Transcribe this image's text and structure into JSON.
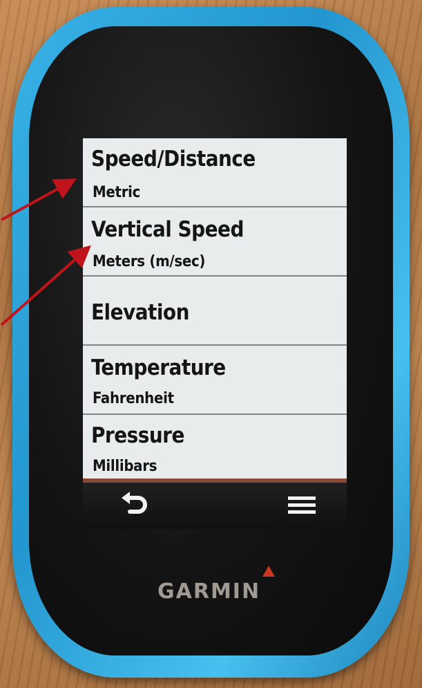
{
  "device": {
    "brand": "GARMIN"
  },
  "screen": {
    "menu_items": [
      {
        "title": "Speed/Distance",
        "subtitle": "Metric"
      },
      {
        "title": "Vertical Speed",
        "subtitle": "Meters (m/sec)"
      },
      {
        "title": "Elevation",
        "subtitle": ""
      },
      {
        "title": "Temperature",
        "subtitle": "Fahrenheit"
      },
      {
        "title": "Pressure",
        "subtitle": "Millibars"
      }
    ],
    "softkeys": {
      "back_icon": "back-arrow-icon",
      "menu_icon": "hamburger-menu-icon"
    }
  },
  "colors": {
    "device_body": "#2aa6dc",
    "screen_background": "#e9ecec",
    "annotation_arrow": "#c0141c"
  }
}
